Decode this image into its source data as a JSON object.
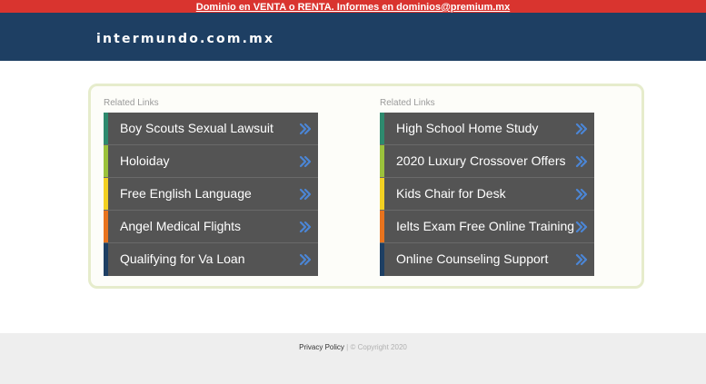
{
  "topbar": {
    "text": "Dominio en VENTA o RENTA. Informes en dominios@premium.mx"
  },
  "header": {
    "site_name": "intermundo.com.mx"
  },
  "columns": [
    {
      "title": "Related Links",
      "links": [
        {
          "label": "Boy Scouts Sexual Lawsuit",
          "color": "#2e8a6e"
        },
        {
          "label": "Holoiday",
          "color": "#9bc23c"
        },
        {
          "label": "Free English Language",
          "color": "#f2d022"
        },
        {
          "label": "Angel Medical Flights",
          "color": "#e8731e"
        },
        {
          "label": "Qualifying for Va Loan",
          "color": "#1e3f63"
        }
      ]
    },
    {
      "title": "Related Links",
      "links": [
        {
          "label": "High School Home Study",
          "color": "#2e8a6e"
        },
        {
          "label": "2020 Luxury Crossover Offers",
          "color": "#9bc23c"
        },
        {
          "label": "Kids Chair for Desk",
          "color": "#f2d022"
        },
        {
          "label": "Ielts Exam Free Online Training",
          "color": "#e8731e"
        },
        {
          "label": "Online Counseling Support",
          "color": "#1e3f63"
        }
      ]
    }
  ],
  "footer": {
    "privacy_label": "Privacy Policy",
    "separator": " | ",
    "copyright": "© Copyright 2020"
  },
  "icons": {
    "link_arrow": "double-chevron-right-icon"
  },
  "colors": {
    "accent_red": "#d9342f",
    "header_blue": "#1e3f63",
    "link_bg": "#545454",
    "chevron_blue": "#4b86d6"
  }
}
